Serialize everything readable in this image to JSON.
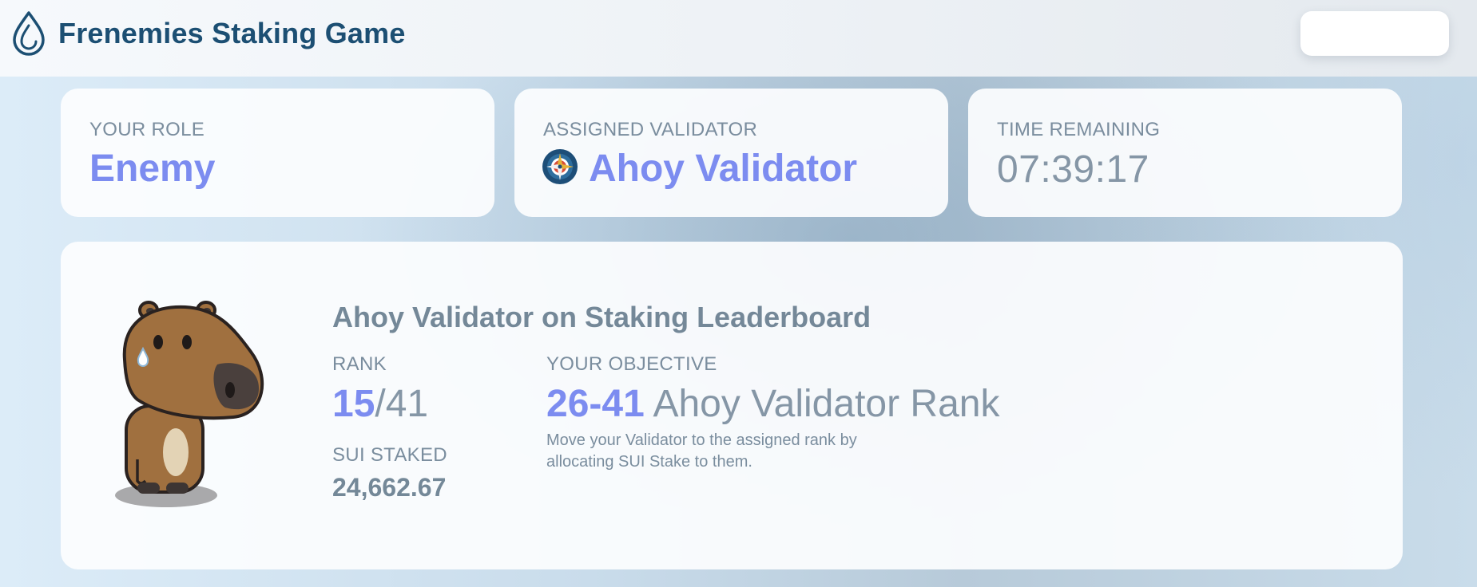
{
  "app": {
    "title": "Frenemies Staking Game",
    "logo_icon": "sui-droplet-icon"
  },
  "header": {
    "wallet_button_label": ""
  },
  "stats": {
    "role": {
      "label": "YOUR ROLE",
      "value": "Enemy"
    },
    "validator": {
      "label": "ASSIGNED VALIDATOR",
      "value": "Ahoy Validator",
      "avatar_icon": "validator-compass-avatar"
    },
    "time": {
      "label": "TIME REMAINING",
      "value": "07:39:17"
    }
  },
  "leaderboard": {
    "title": "Ahoy Validator on Staking Leaderboard",
    "mascot_icon": "capybara-mascot",
    "rank_label": "RANK",
    "rank_current": "15",
    "rank_total": "/41",
    "staked_label": "SUI STAKED",
    "staked_value": "24,662.67",
    "objective_label": "YOUR OBJECTIVE",
    "objective_range": "26-41",
    "objective_text": " Ahoy Validator Rank",
    "objective_desc": "Move your Validator to the assigned rank by allocating SUI Stake to them."
  },
  "colors": {
    "accent": "#7c8cf0",
    "brand": "#1c4f73",
    "muted_text": "#7a8d9e"
  }
}
